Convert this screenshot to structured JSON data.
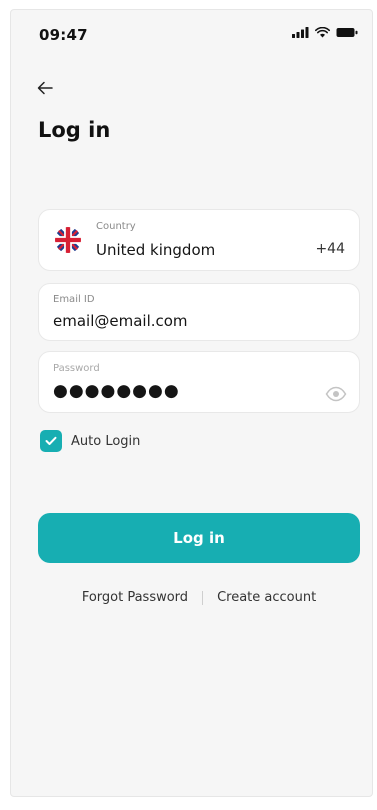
{
  "status_bar": {
    "time": "09:47",
    "icons": [
      "signal-icon",
      "wifi-icon",
      "battery-icon"
    ]
  },
  "header": {
    "back_icon": "arrow-left-icon",
    "title": "Log in"
  },
  "form": {
    "country": {
      "label": "Country",
      "value": "United kingdom",
      "dial_code": "+44",
      "flag_icon": "uk-flag-icon"
    },
    "email": {
      "label": "Email ID",
      "value": "email@email.com"
    },
    "password": {
      "label": "Password",
      "value": "●●●●●●●●",
      "toggle_icon": "eye-icon"
    },
    "auto_login": {
      "label": "Auto Login",
      "checked": true
    }
  },
  "actions": {
    "login_label": "Log in",
    "forgot_password": "Forgot Password",
    "create_account": "Create account"
  },
  "colors": {
    "accent": "#17aeb2",
    "background": "#f6f6f6",
    "field_background": "#ffffff"
  }
}
